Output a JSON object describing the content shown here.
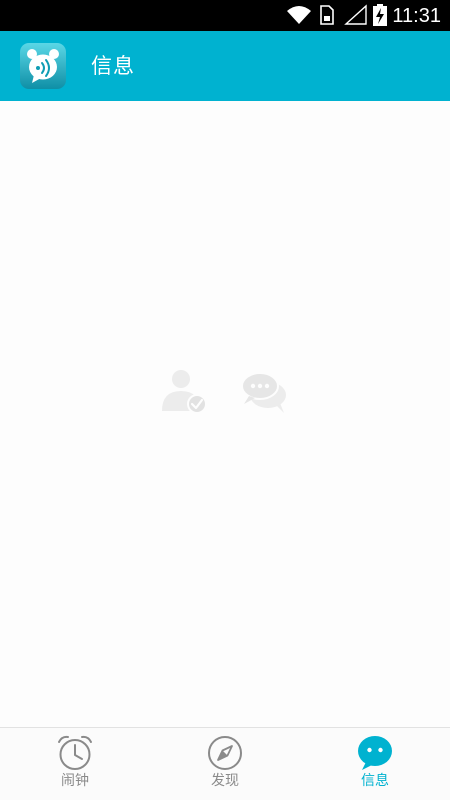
{
  "status_bar": {
    "time": "11:31",
    "icons": [
      "wifi-icon",
      "sim-card-icon",
      "signal-icon",
      "battery-charging-icon"
    ]
  },
  "app_bar": {
    "title": "信息",
    "logo_icon": "alarm-chat-logo-icon",
    "background_color": "#00b2d0"
  },
  "empty_state": {
    "icons": [
      "contacts-check-icon",
      "chat-bubbles-icon"
    ]
  },
  "bottom_nav": {
    "active_index": 2,
    "active_color": "#00b2d0",
    "items": [
      {
        "label": "闹钟",
        "icon": "alarm-clock-icon"
      },
      {
        "label": "发现",
        "icon": "compass-icon"
      },
      {
        "label": "信息",
        "icon": "message-bubble-icon"
      }
    ]
  }
}
